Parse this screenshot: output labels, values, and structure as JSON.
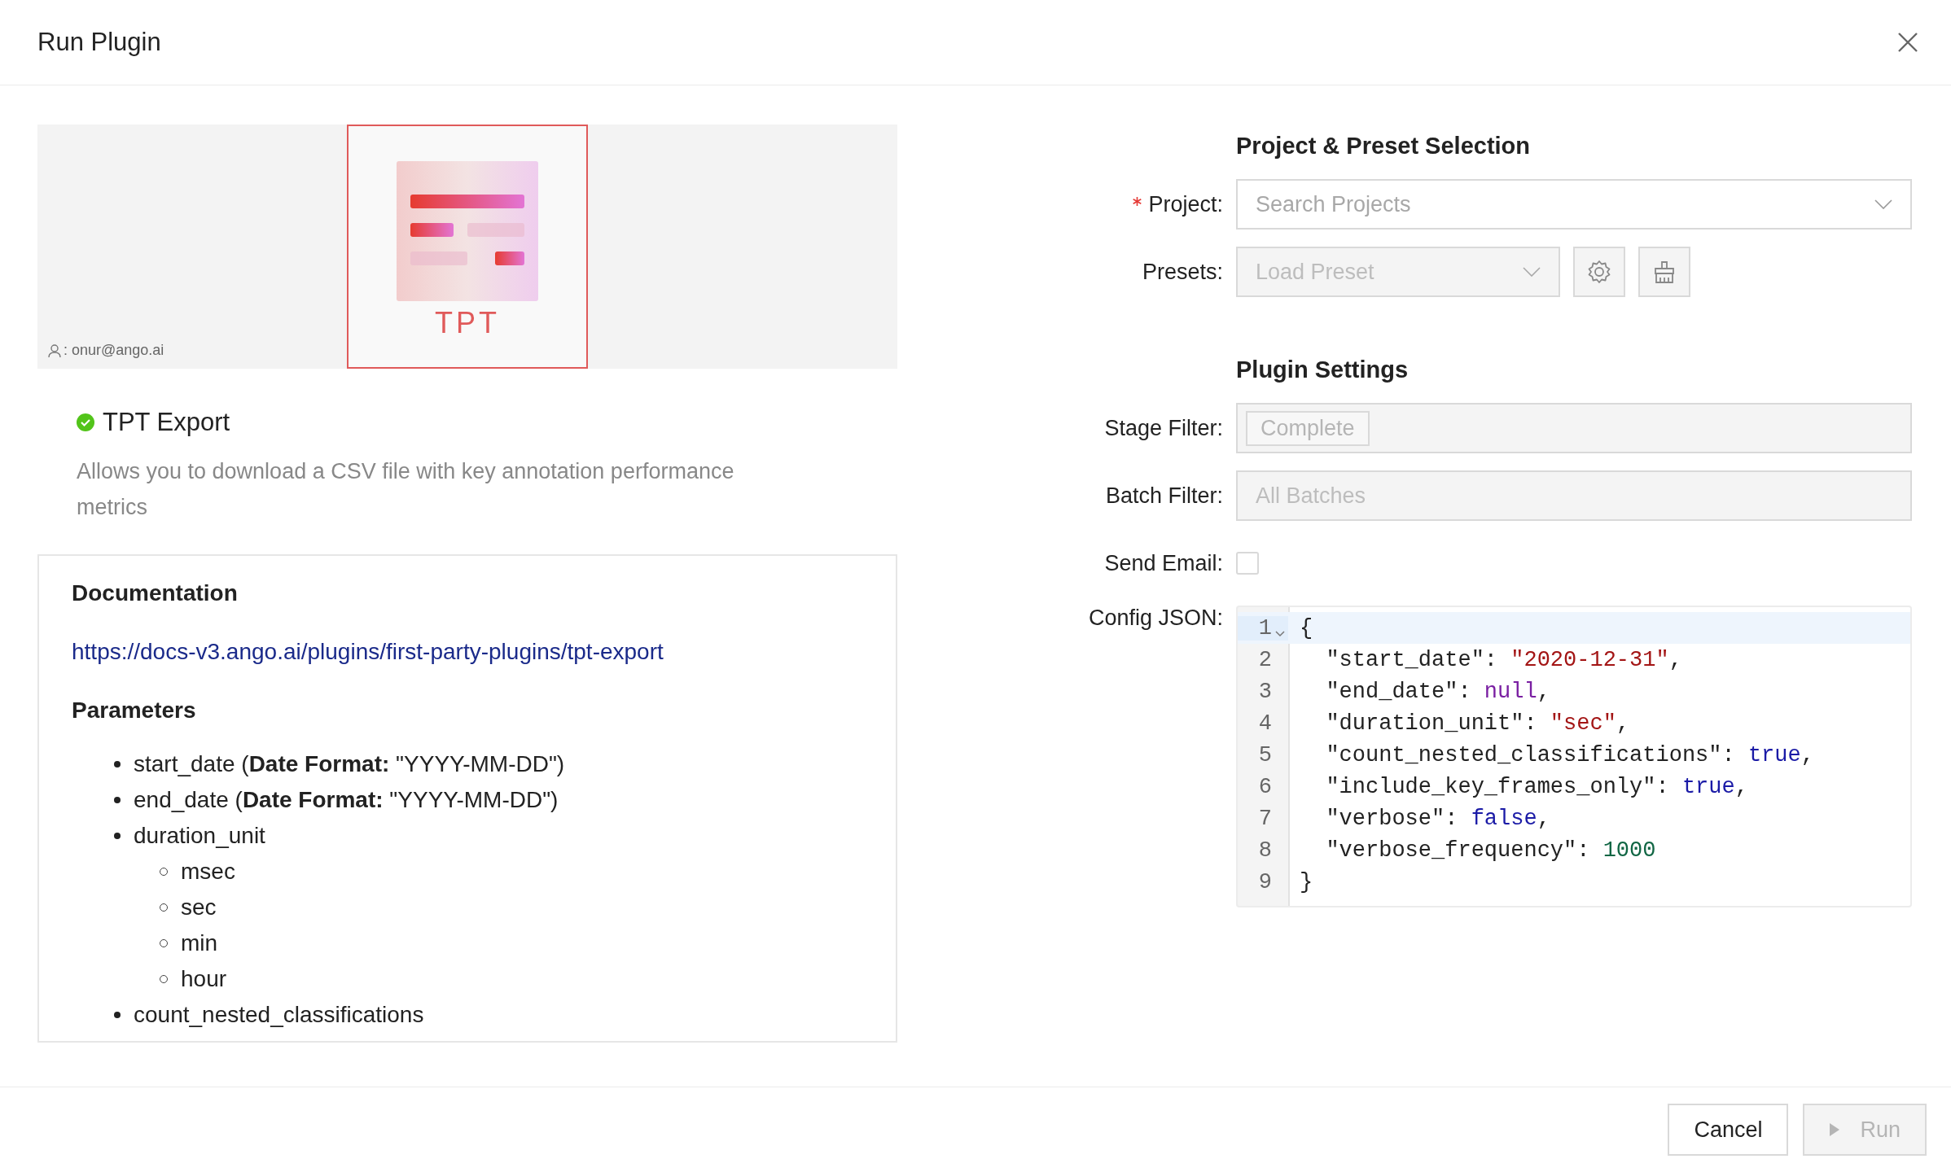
{
  "dialog": {
    "title": "Run Plugin"
  },
  "banner": {
    "owner": ": onur@ango.ai",
    "tile_label": "TPT"
  },
  "plugin": {
    "name": "TPT Export",
    "description": "Allows you to download a CSV file with key annotation performance metrics"
  },
  "documentation": {
    "heading": "Documentation",
    "link": "https://docs-v3.ango.ai/plugins/first-party-plugins/tpt-export",
    "parameters_heading": "Parameters",
    "parameters": [
      {
        "text": "start_date (**Date Format:** \"YYYY-MM-DD\")"
      },
      {
        "text": "end_date (**Date Format:** \"YYYY-MM-DD\")"
      },
      {
        "text": "duration_unit",
        "children": [
          {
            "text": "msec"
          },
          {
            "text": "sec"
          },
          {
            "text": "min"
          },
          {
            "text": "hour"
          }
        ]
      },
      {
        "text": "count_nested_classifications"
      }
    ]
  },
  "sections": [
    {
      "heading": "Project & Preset Selection",
      "fields": [
        {
          "kind": "select",
          "label": "Project:",
          "required": true,
          "placeholder": "Search Projects",
          "disabled": false
        },
        {
          "kind": "preset",
          "label": "Presets:",
          "required": false,
          "placeholder": "Load Preset",
          "disabled": true
        }
      ]
    },
    {
      "heading": "Plugin Settings",
      "fields": [
        {
          "kind": "tags",
          "label": "Stage Filter:",
          "required": false,
          "tags": [
            "Complete"
          ],
          "disabled": true
        },
        {
          "kind": "select",
          "label": "Batch Filter:",
          "required": false,
          "placeholder": "All Batches",
          "disabled": true
        },
        {
          "kind": "checkbox",
          "label": "Send Email:",
          "required": false,
          "checked": false
        },
        {
          "kind": "code",
          "label": "Config JSON:",
          "required": false,
          "lines": [
            {
              "number": "1",
              "active": true,
              "foldable": true,
              "tokens": [
                {
                  "kind": "punct",
                  "text": "{"
                }
              ]
            },
            {
              "number": "2",
              "active": false,
              "foldable": false,
              "tokens": [
                {
                  "kind": "key",
                  "text": "  \"start_date\": "
                },
                {
                  "kind": "string",
                  "text": "\"2020-12-31\""
                },
                {
                  "kind": "punct",
                  "text": ","
                }
              ]
            },
            {
              "number": "3",
              "active": false,
              "foldable": false,
              "tokens": [
                {
                  "kind": "key",
                  "text": "  \"end_date\": "
                },
                {
                  "kind": "null",
                  "text": "null"
                },
                {
                  "kind": "punct",
                  "text": ","
                }
              ]
            },
            {
              "number": "4",
              "active": false,
              "foldable": false,
              "tokens": [
                {
                  "kind": "key",
                  "text": "  \"duration_unit\": "
                },
                {
                  "kind": "string",
                  "text": "\"sec\""
                },
                {
                  "kind": "punct",
                  "text": ","
                }
              ]
            },
            {
              "number": "5",
              "active": false,
              "foldable": false,
              "tokens": [
                {
                  "kind": "key",
                  "text": "  \"count_nested_classifications\": "
                },
                {
                  "kind": "bool",
                  "text": "true"
                },
                {
                  "kind": "punct",
                  "text": ","
                }
              ]
            },
            {
              "number": "6",
              "active": false,
              "foldable": false,
              "tokens": [
                {
                  "kind": "key",
                  "text": "  \"include_key_frames_only\": "
                },
                {
                  "kind": "bool",
                  "text": "true"
                },
                {
                  "kind": "punct",
                  "text": ","
                }
              ]
            },
            {
              "number": "7",
              "active": false,
              "foldable": false,
              "tokens": [
                {
                  "kind": "key",
                  "text": "  \"verbose\": "
                },
                {
                  "kind": "bool",
                  "text": "false"
                },
                {
                  "kind": "punct",
                  "text": ","
                }
              ]
            },
            {
              "number": "8",
              "active": false,
              "foldable": false,
              "tokens": [
                {
                  "kind": "key",
                  "text": "  \"verbose_frequency\": "
                },
                {
                  "kind": "number",
                  "text": "1000"
                }
              ]
            },
            {
              "number": "9",
              "active": false,
              "foldable": false,
              "tokens": [
                {
                  "kind": "punct",
                  "text": "}"
                }
              ]
            }
          ]
        }
      ]
    }
  ],
  "footer": {
    "buttons": [
      {
        "kind": "default",
        "label": "Cancel",
        "disabled": false
      },
      {
        "kind": "run",
        "label": "Run",
        "disabled": true
      }
    ]
  }
}
